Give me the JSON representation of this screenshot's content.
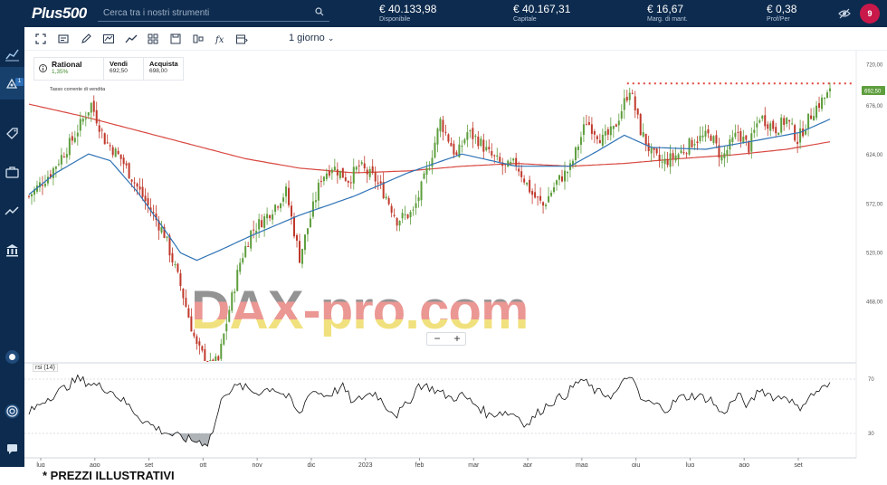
{
  "header": {
    "logo": "Plus500",
    "search_placeholder": "Cerca tra i nostri strumenti",
    "stats": [
      {
        "value": "€ 40.133,98",
        "label": "Disponibile"
      },
      {
        "value": "€ 40.167,31",
        "label": "Capitale"
      },
      {
        "value": "€ 16,67",
        "label": "Marg. di mant."
      },
      {
        "value": "€ 0,38",
        "label": "Prof/Per"
      }
    ],
    "avatar_text": "9"
  },
  "sidebar": {
    "positions_badge": "1"
  },
  "toolbar": {
    "timeframe": "1 giorno"
  },
  "instrument": {
    "name": "Rational",
    "change": "1,35%",
    "sell_label": "Vendi",
    "sell_price": "692,50",
    "buy_label": "Acquista",
    "buy_price": "698,00",
    "rate_note": "Tasso corrente di vendita"
  },
  "zoom": {
    "minus": "−",
    "plus": "+"
  },
  "rsi": {
    "label": "rsi (14)"
  },
  "watermark": "DAX-pro.com",
  "footnote": "* PREZZI ILLUSTRATIVI",
  "colors": {
    "up": "#5e9e3d",
    "down": "#c0392b",
    "ma_fast": "#2f73b5",
    "ma_slow": "#d8473f",
    "topbar": "#0d2b4e",
    "price_tag": "#5e9e3d"
  },
  "chart_data": {
    "type": "candlestick",
    "y_ticks": [
      "720,00",
      "676,00",
      "624,00",
      "572,00",
      "520,00",
      "468,00"
    ],
    "x_ticks": [
      "lug",
      "ago",
      "set",
      "ott",
      "nov",
      "dic",
      "2023",
      "feb",
      "mar",
      "apr",
      "mag",
      "giu",
      "lug",
      "ago",
      "set"
    ],
    "current_price": "692,50",
    "resistance_level": 700,
    "ylim": [
      405,
      730
    ],
    "rsi_ticks": [
      "70",
      "30"
    ],
    "rsi_ylim": [
      20,
      80
    ],
    "waypoints": [
      [
        0,
        580
      ],
      [
        8,
        605
      ],
      [
        16,
        640
      ],
      [
        23,
        678
      ],
      [
        28,
        640
      ],
      [
        34,
        620
      ],
      [
        40,
        590
      ],
      [
        50,
        540
      ],
      [
        56,
        485
      ],
      [
        62,
        420
      ],
      [
        67,
        400
      ],
      [
        70,
        405
      ],
      [
        74,
        460
      ],
      [
        78,
        510
      ],
      [
        82,
        542
      ],
      [
        88,
        560
      ],
      [
        95,
        585
      ],
      [
        100,
        515
      ],
      [
        108,
        600
      ],
      [
        112,
        612
      ],
      [
        118,
        598
      ],
      [
        122,
        612
      ],
      [
        128,
        598
      ],
      [
        132,
        580
      ],
      [
        136,
        555
      ],
      [
        142,
        563
      ],
      [
        148,
        615
      ],
      [
        152,
        660
      ],
      [
        158,
        622
      ],
      [
        162,
        648
      ],
      [
        166,
        640
      ],
      [
        170,
        625
      ],
      [
        176,
        610
      ],
      [
        180,
        615
      ],
      [
        186,
        582
      ],
      [
        190,
        570
      ],
      [
        195,
        595
      ],
      [
        200,
        610
      ],
      [
        206,
        660
      ],
      [
        212,
        640
      ],
      [
        216,
        650
      ],
      [
        220,
        680
      ],
      [
        222,
        695
      ],
      [
        226,
        650
      ],
      [
        230,
        625
      ],
      [
        234,
        615
      ],
      [
        240,
        625
      ],
      [
        246,
        640
      ],
      [
        252,
        645
      ],
      [
        256,
        620
      ],
      [
        262,
        648
      ],
      [
        266,
        632
      ],
      [
        270,
        665
      ],
      [
        276,
        652
      ],
      [
        280,
        662
      ],
      [
        284,
        640
      ],
      [
        290,
        672
      ],
      [
        294,
        685
      ],
      [
        296,
        690
      ]
    ],
    "ma_fast": [
      [
        0,
        582
      ],
      [
        10,
        605
      ],
      [
        22,
        625
      ],
      [
        30,
        618
      ],
      [
        40,
        585
      ],
      [
        50,
        545
      ],
      [
        56,
        520
      ],
      [
        62,
        512
      ],
      [
        70,
        522
      ],
      [
        82,
        538
      ],
      [
        100,
        560
      ],
      [
        120,
        580
      ],
      [
        140,
        605
      ],
      [
        160,
        625
      ],
      [
        180,
        612
      ],
      [
        200,
        612
      ],
      [
        210,
        628
      ],
      [
        220,
        645
      ],
      [
        230,
        632
      ],
      [
        250,
        630
      ],
      [
        270,
        640
      ],
      [
        285,
        648
      ],
      [
        296,
        662
      ]
    ],
    "ma_slow": [
      [
        0,
        678
      ],
      [
        20,
        665
      ],
      [
        40,
        650
      ],
      [
        60,
        635
      ],
      [
        80,
        620
      ],
      [
        100,
        610
      ],
      [
        120,
        605
      ],
      [
        140,
        607
      ],
      [
        160,
        612
      ],
      [
        180,
        615
      ],
      [
        200,
        612
      ],
      [
        220,
        615
      ],
      [
        240,
        620
      ],
      [
        260,
        624
      ],
      [
        280,
        630
      ],
      [
        296,
        638
      ]
    ],
    "rsi_waypoints": [
      [
        0,
        45
      ],
      [
        6,
        55
      ],
      [
        12,
        62
      ],
      [
        18,
        70
      ],
      [
        24,
        66
      ],
      [
        30,
        62
      ],
      [
        36,
        52
      ],
      [
        42,
        40
      ],
      [
        48,
        33
      ],
      [
        54,
        28
      ],
      [
        60,
        25
      ],
      [
        66,
        23
      ],
      [
        68,
        32
      ],
      [
        72,
        60
      ],
      [
        78,
        65
      ],
      [
        84,
        60
      ],
      [
        90,
        64
      ],
      [
        96,
        56
      ],
      [
        100,
        43
      ],
      [
        104,
        62
      ],
      [
        110,
        58
      ],
      [
        116,
        64
      ],
      [
        120,
        52
      ],
      [
        124,
        58
      ],
      [
        128,
        60
      ],
      [
        132,
        50
      ],
      [
        136,
        44
      ],
      [
        140,
        52
      ],
      [
        144,
        66
      ],
      [
        148,
        64
      ],
      [
        152,
        60
      ],
      [
        156,
        56
      ],
      [
        160,
        58
      ],
      [
        166,
        50
      ],
      [
        170,
        43
      ],
      [
        174,
        46
      ],
      [
        180,
        44
      ],
      [
        184,
        36
      ],
      [
        188,
        45
      ],
      [
        192,
        52
      ],
      [
        198,
        58
      ],
      [
        204,
        70
      ],
      [
        210,
        60
      ],
      [
        216,
        58
      ],
      [
        220,
        68
      ],
      [
        222,
        74
      ],
      [
        226,
        55
      ],
      [
        230,
        52
      ],
      [
        236,
        48
      ],
      [
        240,
        56
      ],
      [
        246,
        58
      ],
      [
        252,
        55
      ],
      [
        256,
        44
      ],
      [
        262,
        58
      ],
      [
        266,
        50
      ],
      [
        270,
        63
      ],
      [
        276,
        56
      ],
      [
        280,
        58
      ],
      [
        284,
        48
      ],
      [
        288,
        56
      ],
      [
        292,
        62
      ],
      [
        296,
        65
      ]
    ]
  }
}
